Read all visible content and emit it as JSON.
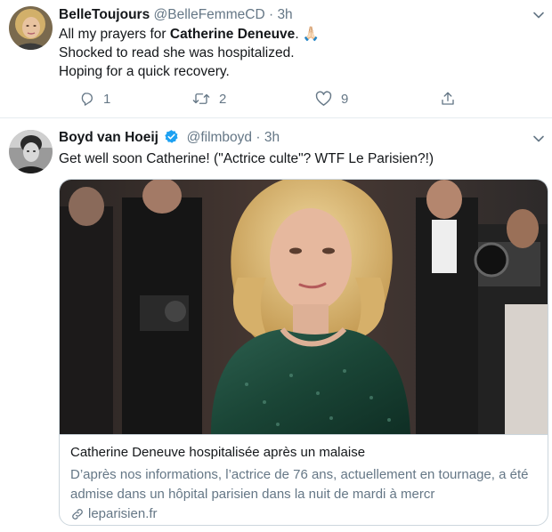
{
  "tweets": [
    {
      "display_name": "BelleToujours",
      "handle": "@BelleFemmeCD",
      "separator": "·",
      "time": "3h",
      "avatar_icon": "woman-portrait-avatar",
      "text": {
        "line1_before": "All my prayers for ",
        "line1_bold": "Catherine Deneuve",
        "line1_after": ". 🙏🏻",
        "line2": "Shocked to read she was hospitalized.",
        "line3": "Hoping for a quick recovery."
      },
      "actions": {
        "reply_count": "1",
        "retweet_count": "2",
        "like_count": "9"
      }
    },
    {
      "display_name": "Boyd van Hoeij",
      "verified": true,
      "handle": "@filmboyd",
      "separator": "·",
      "time": "3h",
      "avatar_icon": "man-portrait-bw-avatar",
      "text": "Get well soon Catherine! (\"Actrice culte\"? WTF Le Parisien?!)",
      "card": {
        "image_description_icon": "red-carpet-photo",
        "title": "Catherine Deneuve hospitalisée après un malaise",
        "description_line1": "D’après nos informations, l’actrice de 76 ans, actuellement en tournage, a été",
        "description_line2": "admise dans un hôpital parisien dans la nuit de mardi à mercr",
        "domain": "leparisien.fr",
        "domain_icon": "link-icon"
      }
    }
  ],
  "colors": {
    "text_primary": "#14171a",
    "text_secondary": "#657786",
    "verified_blue": "#1da1f2",
    "border": "#ccd6dd",
    "dress_green": "#1f4a3c"
  }
}
